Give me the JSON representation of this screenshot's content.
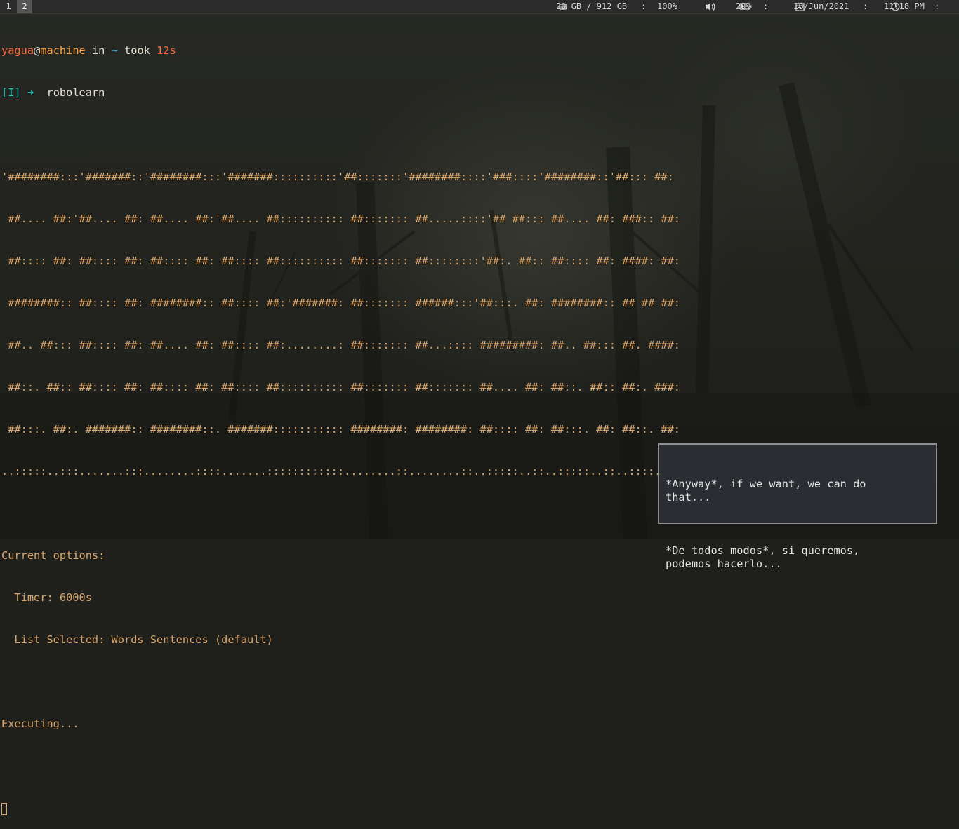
{
  "topbar": {
    "workspaces": [
      "1",
      "2"
    ],
    "active_workspace": "2",
    "disk_icon": "hard-drive-icon",
    "disk": "20 GB / 912 GB",
    "volume": "100%",
    "volume_icon": "speaker-icon",
    "battery_icon": "battery-icon",
    "battery": "29%",
    "calendar_icon": "calendar-icon",
    "date": "18/Jun/2021",
    "clock_icon": "clock-icon",
    "time": "11:18 PM",
    "wifi_icon": "wifi-icon",
    "separator": ":"
  },
  "terminal": {
    "prompt": {
      "user": "yagua",
      "at": "@",
      "host": "machine",
      "in": " in ",
      "dir": "~",
      "took": " took ",
      "duration": "12s",
      "mode": "[I]",
      "arrow": "➜",
      "command": "robolearn"
    },
    "ascii_art": [
      "'########:::'#######::'########:::'#######::::::::::'##:::::::'########::::'###::::'########::'##::: ##:",
      " ##.... ##:'##.... ##: ##.... ##:'##.... ##:::::::::: ##::::::: ##.....::::'## ##::: ##.... ##: ###:: ##:",
      " ##:::: ##: ##:::: ##: ##:::: ##: ##:::: ##:::::::::: ##::::::: ##::::::::'##:. ##:: ##:::: ##: ####: ##:",
      " ########:: ##:::: ##: ########:: ##:::: ##:'#######: ##::::::: ######:::'##:::. ##: ########:: ## ## ##:",
      " ##.. ##::: ##:::: ##: ##.... ##: ##:::: ##:........: ##::::::: ##...:::: #########: ##.. ##::: ##. ####:",
      " ##::. ##:: ##:::: ##: ##:::: ##: ##:::: ##:::::::::: ##::::::: ##::::::: ##.... ##: ##::. ##:: ##:. ###:",
      " ##:::. ##:. #######:: ########::. #######::::::::::: ########: ########: ##:::: ##: ##:::. ##: ##::. ##:",
      "..:::::..:::.......:::........::::.......::::::::::::........::........::..:::::..::..:::::..::..::::..::"
    ],
    "options_header": "Current options:",
    "timer": "  Timer: 6000s",
    "list_selected": "  List Selected: Words Sentences (default)",
    "status": "Executing..."
  },
  "notification": {
    "english": "*Anyway*, if we want, we can do\nthat...",
    "spanish": "*De todos modos*, si queremos,\npodemos hacerlo..."
  }
}
